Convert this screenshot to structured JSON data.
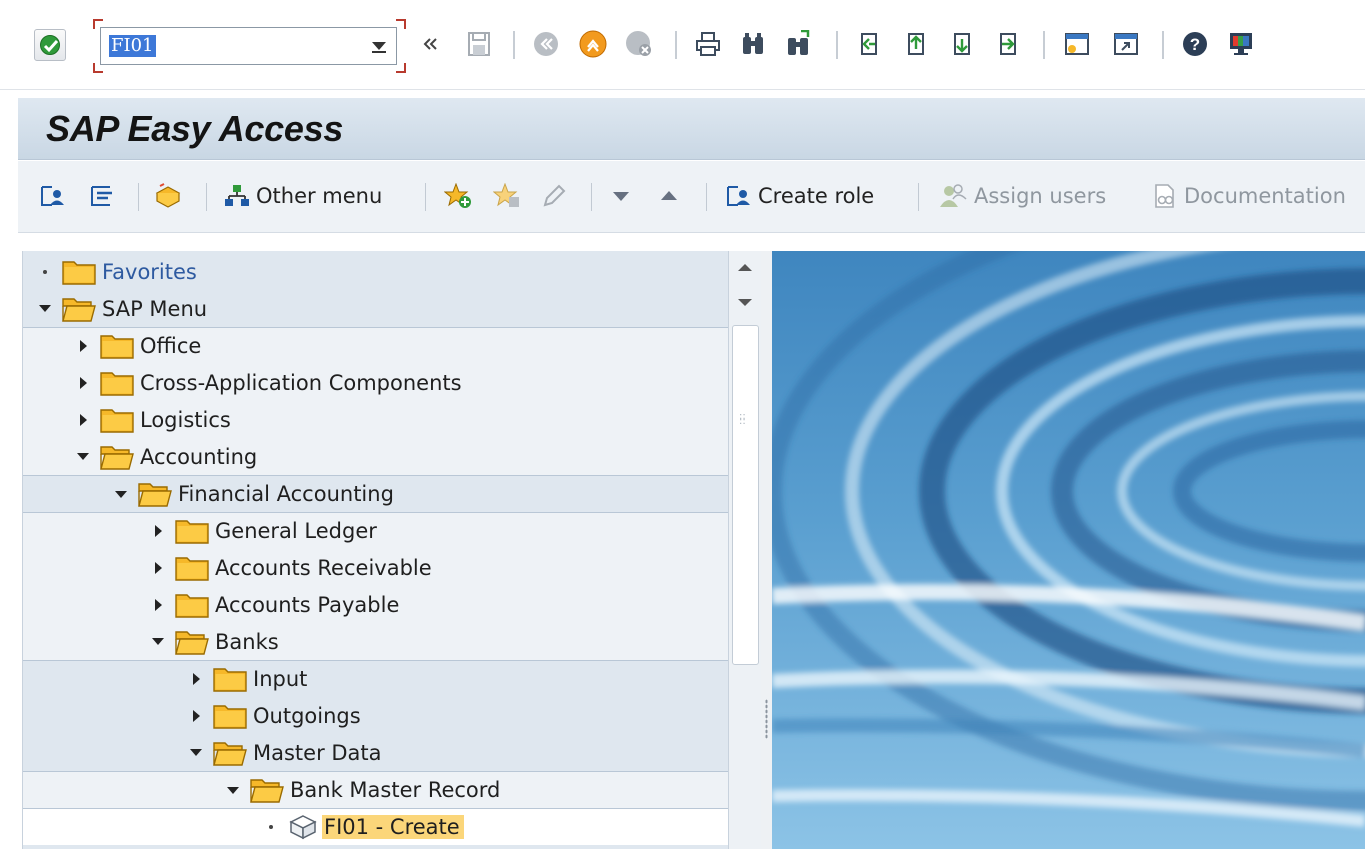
{
  "system_toolbar": {
    "enter_icon": "check-icon",
    "command_field_value": "FI01",
    "icons": [
      "double-left-icon",
      "save-icon",
      "back-icon",
      "exit-icon",
      "cancel-icon",
      "print-icon",
      "find-icon",
      "find-next-icon",
      "first-page-icon",
      "previous-page-icon",
      "next-page-icon",
      "last-page-icon",
      "create-session-icon",
      "shortcut-icon",
      "help-icon",
      "customize-layout-icon"
    ]
  },
  "title": "SAP Easy Access",
  "app_toolbar": {
    "other_menu": "Other menu",
    "create_role": "Create role",
    "assign_users": "Assign users",
    "documentation": "Documentation"
  },
  "tree": {
    "favorites": "Favorites",
    "sap_menu": "SAP Menu",
    "office": "Office",
    "cross_app": "Cross-Application Components",
    "logistics": "Logistics",
    "accounting": "Accounting",
    "financial_accounting": "Financial Accounting",
    "general_ledger": "General Ledger",
    "accounts_receivable": "Accounts Receivable",
    "accounts_payable": "Accounts Payable",
    "banks": "Banks",
    "input": "Input",
    "outgoings": "Outgoings",
    "master_data": "Master Data",
    "bank_master_record": "Bank Master Record",
    "fi01_create": "FI01 - Create"
  },
  "colors": {
    "folder": "#f6b829",
    "selected_row": "#fbd67a",
    "tree_background": "#dfe7ef",
    "title_bar": "#d3dfeb"
  }
}
